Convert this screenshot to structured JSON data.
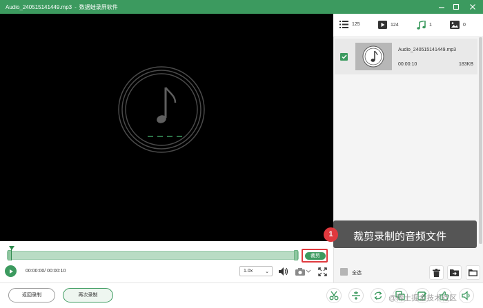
{
  "window": {
    "file_title": "Audio_240515141449.mp3",
    "separator": "-",
    "app_name": "数据蛙录屏软件"
  },
  "colors": {
    "accent": "#3c9a5f",
    "highlight": "#e0393e",
    "callout_bg": "#555555"
  },
  "player": {
    "current_time": "00:00:00",
    "time_separator": "/",
    "total_time": "00:00:10",
    "speed": "1.0x",
    "cut_label": "裁剪"
  },
  "tabs": [
    {
      "icon": "list-icon",
      "count": "125"
    },
    {
      "icon": "video-icon",
      "count": "124"
    },
    {
      "icon": "music-note-icon",
      "count": "1"
    },
    {
      "icon": "image-icon",
      "count": "0"
    }
  ],
  "file": {
    "name": "Audio_240515141449.mp3",
    "duration": "00:00:10",
    "size": "183KB"
  },
  "select_all_label": "全选",
  "callout": {
    "number": "1",
    "text": "裁剪录制的音频文件"
  },
  "bottom": {
    "return_label": "返回录制",
    "again_label": "再次录制"
  },
  "watermark": "@稀土掘金技术社区"
}
